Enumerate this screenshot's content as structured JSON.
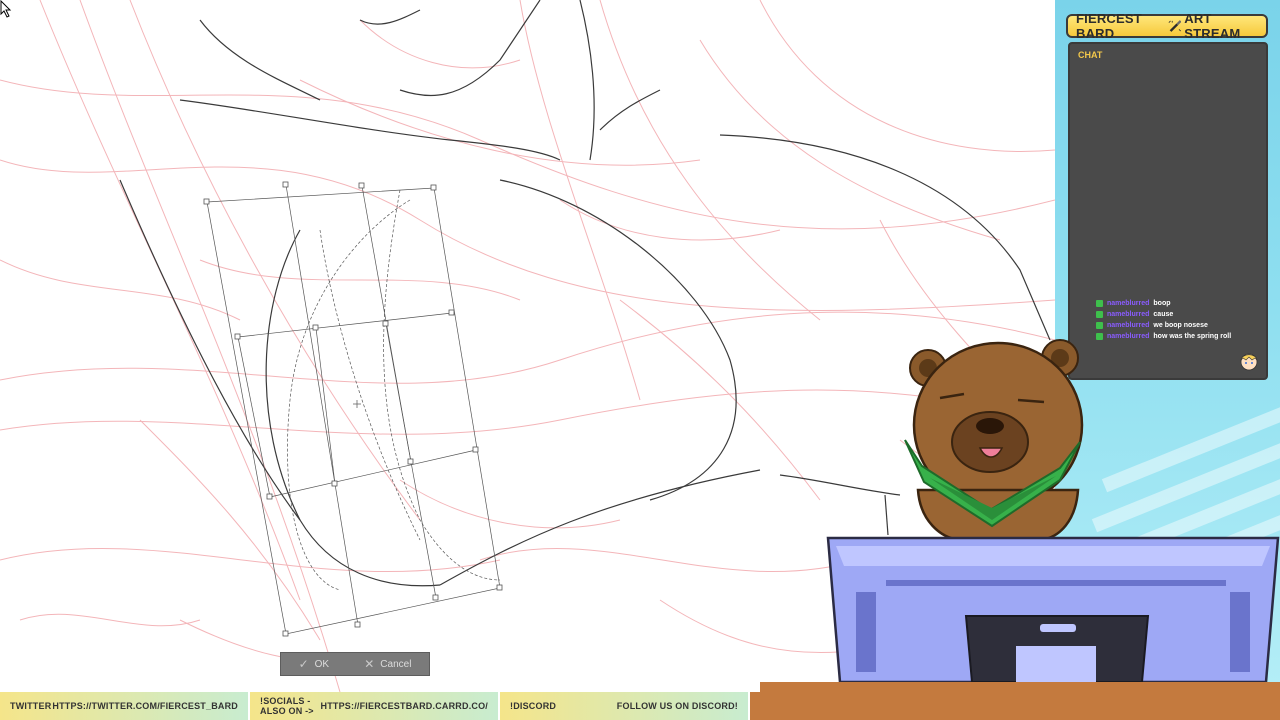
{
  "header": {
    "name": "FIERCEST BARD",
    "stream_label": "ART STREAM"
  },
  "chat": {
    "title": "CHAT",
    "messages": [
      {
        "user": "nameblurred",
        "text": "boop"
      },
      {
        "user": "nameblurred",
        "text": "cause"
      },
      {
        "user": "nameblurred",
        "text": "we boop nosese"
      },
      {
        "user": "nameblurred",
        "text": "how was the spring roll"
      }
    ]
  },
  "transform_bar": {
    "ok_label": "OK",
    "cancel_label": "Cancel"
  },
  "ticker": [
    {
      "label": "TWITTER",
      "value": "HTTPS://TWITTER.COM/FIERCEST_BARD"
    },
    {
      "label": "!SOCIALS - ALSO ON ->",
      "value": "HTTPS://FIERCESTBARD.CARRD.CO/"
    },
    {
      "label": "!DISCORD",
      "value": "FOLLOW US ON DISCORD!"
    }
  ],
  "colors": {
    "sketch_red": "#f2a9ad",
    "line_dark": "#3a3a3a",
    "header_yellow": "#f6c93c",
    "chat_bg": "#4a4a4a",
    "accent_purple": "#8a5cff"
  }
}
